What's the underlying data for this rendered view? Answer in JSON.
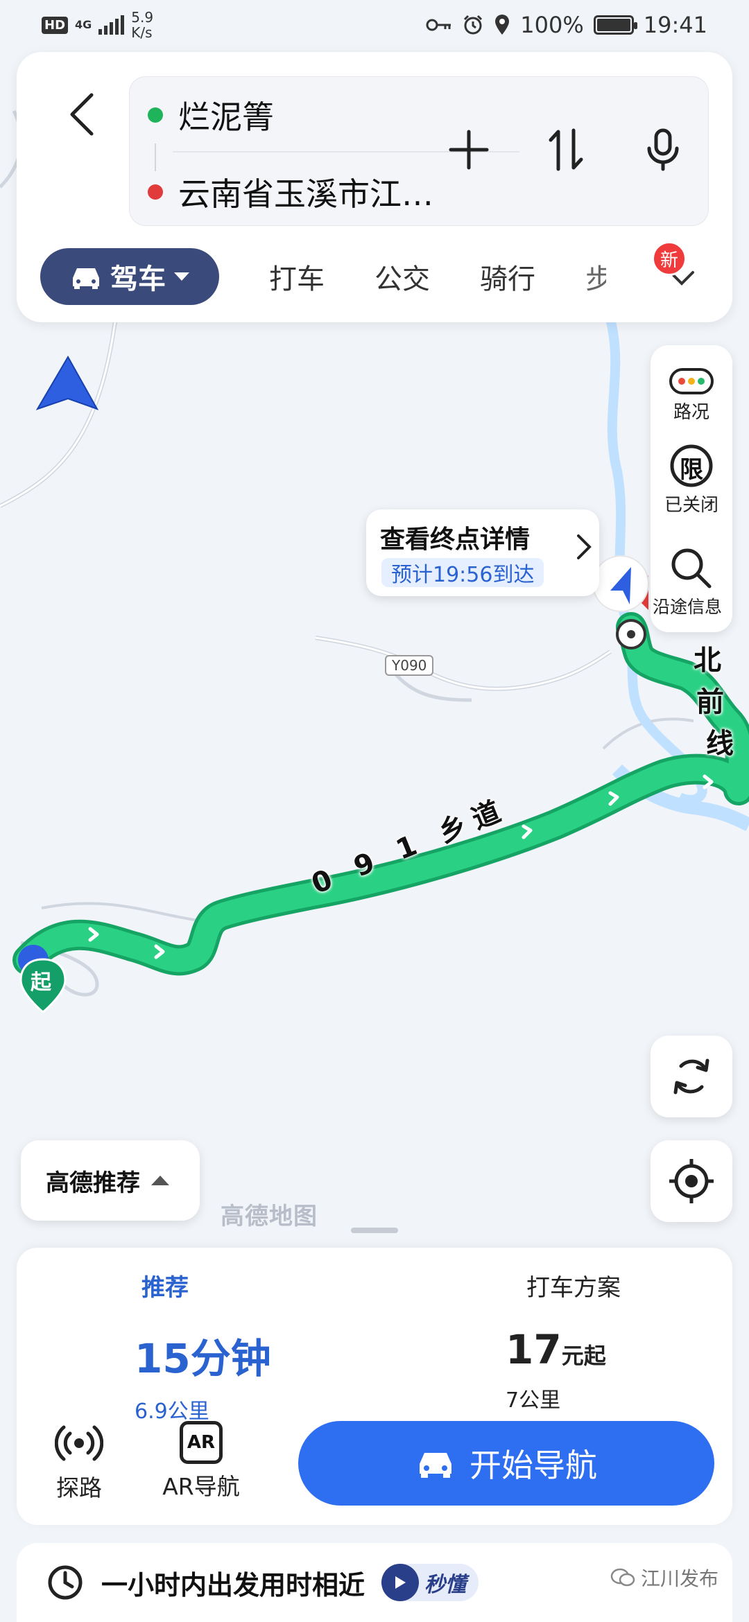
{
  "status_bar": {
    "hd": "HD",
    "network": "4G",
    "speed_value": "5.9",
    "speed_unit": "K/s",
    "battery": "100%",
    "battery_level": 1.0,
    "time": "19:41"
  },
  "route": {
    "origin": "烂泥箐",
    "destination": "云南省玉溪市江…",
    "origin_color": "#1fb35b",
    "destination_color": "#e23b3b"
  },
  "modes": {
    "active": "驾车",
    "items": [
      "打车",
      "公交",
      "骑行",
      "步"
    ],
    "new_badge": "新"
  },
  "map": {
    "route_color": "#27c27a",
    "route_outline": "#15a464",
    "water_color": "#bfe1ff",
    "road_label_1": "0 9 1 乡道",
    "road_label_2_chars": [
      "北",
      "前",
      "线"
    ],
    "road_shield": "Y090",
    "start_marker": "起",
    "watermark": "高德地图"
  },
  "side_panel": {
    "traffic": "路况",
    "restriction_icon": "限",
    "restriction": "已关闭",
    "along_route": "沿途信息"
  },
  "destination_callout": {
    "title": "查看终点详情",
    "eta": "预计19:56到达"
  },
  "recommend_pill": "高德推荐",
  "plans": [
    {
      "tag": "推荐",
      "time_value": "15分钟",
      "distance": "6.9公里"
    },
    {
      "tag": "打车方案",
      "price": "17",
      "price_unit": "元起",
      "distance": "7公里"
    }
  ],
  "tools": {
    "explore": "探路",
    "ar_icon_text": "AR",
    "ar": "AR导航"
  },
  "start_button": "开始导航",
  "footer": {
    "text": "一小时内出发用时相近",
    "miaodong": "秒懂",
    "source": "江川发布"
  },
  "accent_color": "#2d6ff0"
}
